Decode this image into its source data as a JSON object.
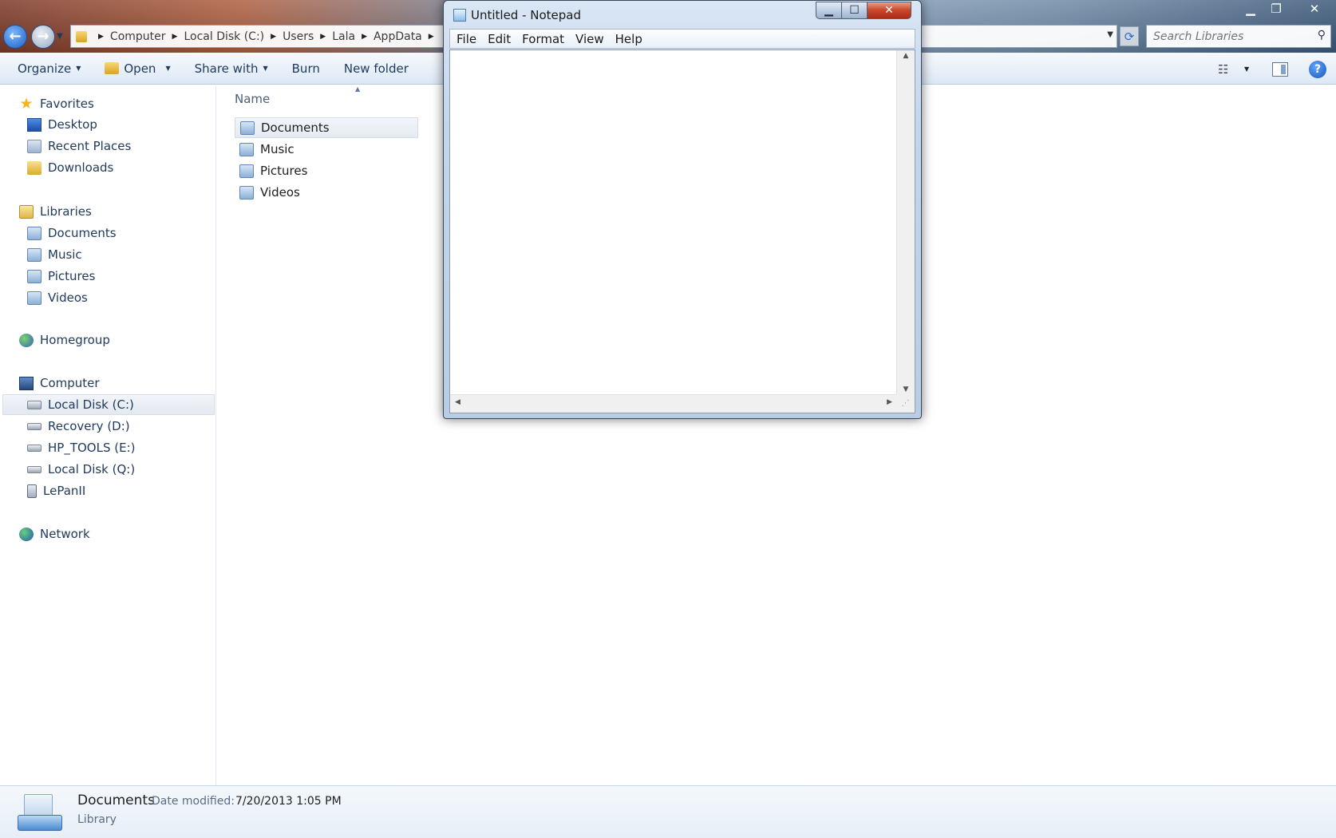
{
  "explorer": {
    "address": {
      "crumbs": [
        "Computer",
        "Local Disk (C:)",
        "Users",
        "Lala",
        "AppData"
      ]
    },
    "search_placeholder": "Search Libraries",
    "toolbar": {
      "organize": "Organize",
      "open": "Open",
      "share_with": "Share with",
      "burn": "Burn",
      "new_folder": "New folder"
    },
    "nav": {
      "favorites": {
        "label": "Favorites",
        "items": [
          "Desktop",
          "Recent Places",
          "Downloads"
        ]
      },
      "libraries": {
        "label": "Libraries",
        "items": [
          "Documents",
          "Music",
          "Pictures",
          "Videos"
        ]
      },
      "homegroup": "Homegroup",
      "computer": {
        "label": "Computer",
        "items": [
          "Local Disk (C:)",
          "Recovery (D:)",
          "HP_TOOLS (E:)",
          "Local Disk (Q:)",
          "LePanII"
        ],
        "selected": "Local Disk (C:)"
      },
      "network": "Network"
    },
    "content": {
      "column_name": "Name",
      "files": [
        "Documents",
        "Music",
        "Pictures",
        "Videos"
      ],
      "selected": "Documents"
    },
    "details": {
      "name": "Documents",
      "modified_label": "Date modified:",
      "modified_value": "7/20/2013 1:05 PM",
      "type": "Library"
    }
  },
  "notepad": {
    "title": "Untitled - Notepad",
    "menus": [
      "File",
      "Edit",
      "Format",
      "View",
      "Help"
    ],
    "text": ""
  },
  "colors": {
    "accent": "#1e395b",
    "close_red": "#c8452a",
    "selection": "#e5ebf2"
  }
}
